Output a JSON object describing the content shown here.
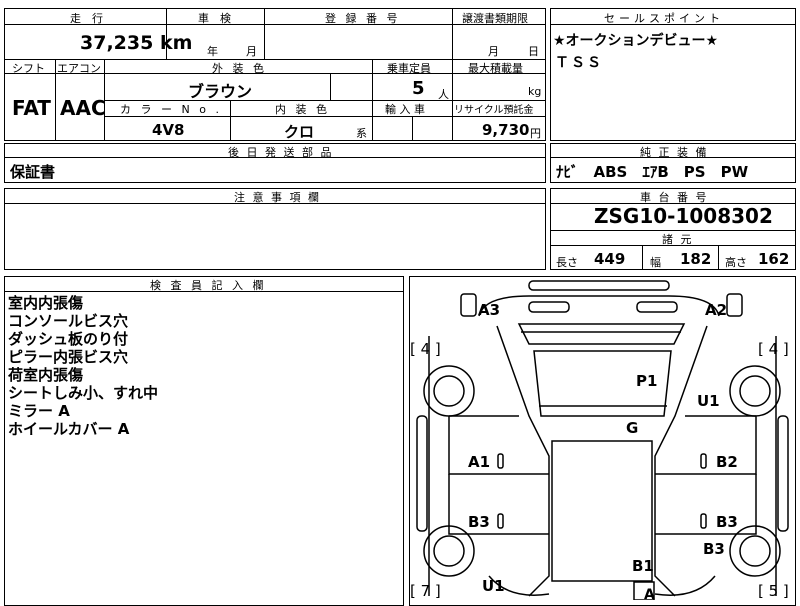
{
  "headers": {
    "mileage": "走　行",
    "inspection": "車　検",
    "registration": "登 録 番 号",
    "transfer_deadline": "譲渡書類期限",
    "sales_point": "セールスポイント",
    "shift": "シフト",
    "aircon": "エアコン",
    "exterior_color": "外 装 色",
    "capacity": "乗車定員",
    "max_load": "最大積載量",
    "color_no": "カ ラ ー N o .",
    "interior_color": "内 装 色",
    "import": "輸 入 車",
    "recycle": "リサイクル預託金",
    "later_parts": "後 日 発 送 部 品",
    "equipment": "純 正 装 備",
    "notes": "注 意 事 項 欄",
    "chassis": "車 台 番 号",
    "specs": "諸 元",
    "inspector": "検 査 員 記 入 欄"
  },
  "values": {
    "mileage": "37,235",
    "mileage_unit": "km",
    "inspection_year": "年",
    "inspection_month": "月",
    "deadline_month": "月",
    "deadline_day": "日",
    "shift": "FAT",
    "aircon": "AAC",
    "exterior_color": "ブラウン",
    "capacity": "5",
    "capacity_unit": "人",
    "load_unit": "kg",
    "color_no": "4V8",
    "interior_color": "クロ",
    "interior_suffix": "系",
    "recycle_amount": "9,730",
    "recycle_unit": "円",
    "later_parts": "保証書",
    "equipment": "ﾅﾋﾞ　ABS　ｴｱB　PS　PW",
    "chassis_number": "ZSG10-1008302",
    "length_label": "長さ",
    "length": "449",
    "width_label": "幅",
    "width": "182",
    "height_label": "高さ",
    "height": "162"
  },
  "sales_points": [
    "★オークションデビュー★",
    "ＴＳＳ"
  ],
  "inspector_notes": [
    "室内内張傷",
    "コンソールビス穴",
    "ダッシュ板のり付",
    "ピラー内張ビス穴",
    "荷室内張傷",
    "シートしみ小、すれ中",
    "ミラー A",
    "ホイールカバー A"
  ],
  "diagram": {
    "marks": [
      "A3",
      "A2",
      "P1",
      "U1",
      "G",
      "A1",
      "B2",
      "B3",
      "B3",
      "B3",
      "B1",
      "U1",
      "A"
    ],
    "tire_left_top": "[ 4 ]",
    "tire_right_top": "[ 4 ]",
    "tire_left_bottom": "[ 7 ]",
    "tire_right_bottom": "[ 5 ]"
  }
}
